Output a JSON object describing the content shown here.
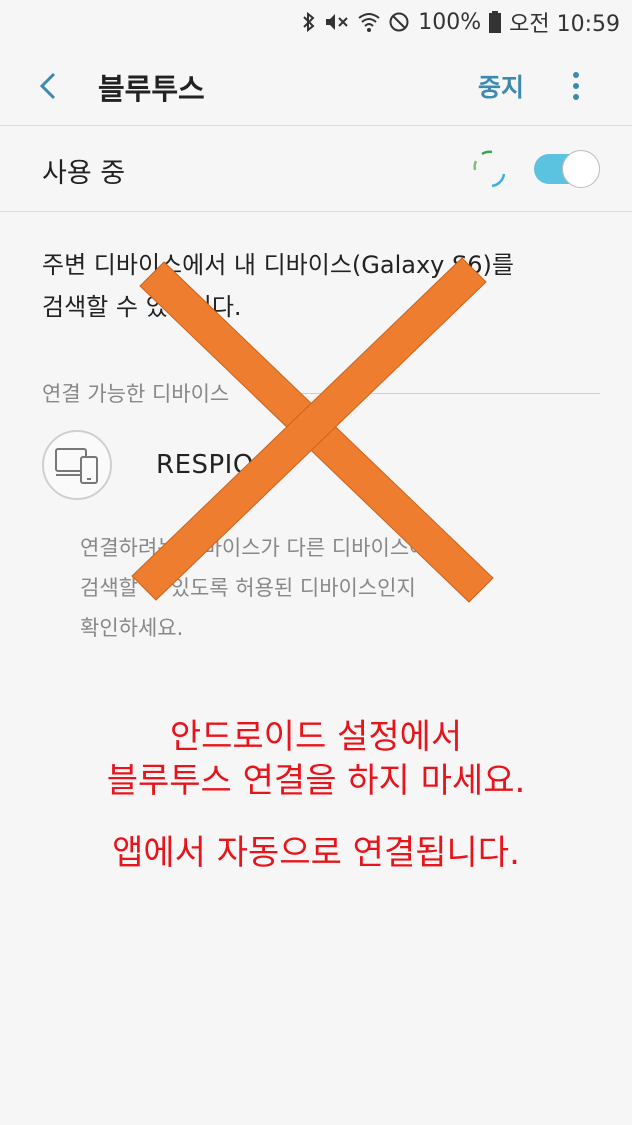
{
  "status_bar": {
    "battery": "100%",
    "time": "오전 10:59",
    "icons": [
      "bluetooth-icon",
      "mute-icon",
      "wifi-icon",
      "blocked-icon",
      "battery-icon"
    ]
  },
  "app_bar": {
    "title": "블루투스",
    "stop_label": "중지",
    "icons": [
      "back-arrow-icon",
      "more-vert-icon"
    ]
  },
  "toggle": {
    "label": "사용 중",
    "state": "on"
  },
  "description": {
    "line1": "주변 디바이스에서 내 디바이스(Galaxy S6)를",
    "line2": "검색할 수 있습니다."
  },
  "available_section": {
    "header": "연결 가능한 디바이스",
    "devices": [
      {
        "name": "RESPIO05",
        "icon": "devices-icon"
      }
    ]
  },
  "help_text": {
    "line1": "연결하려는 디바이스가 다른 디바이스에서",
    "line2": "검색할 수 있도록 허용된 디바이스인지",
    "line3": "확인하세요."
  },
  "notice": {
    "line1": "안드로이드 설정에서",
    "line2": "블루투스 연결을 하지 마세요.",
    "line3": "앱에서 자동으로 연결됩니다."
  },
  "colors": {
    "background": "#f6f6f6",
    "accent": "#3c8ab0",
    "switch_on": "#5bc3e0",
    "cross": "#ee7d30",
    "notice": "#e8141c"
  }
}
